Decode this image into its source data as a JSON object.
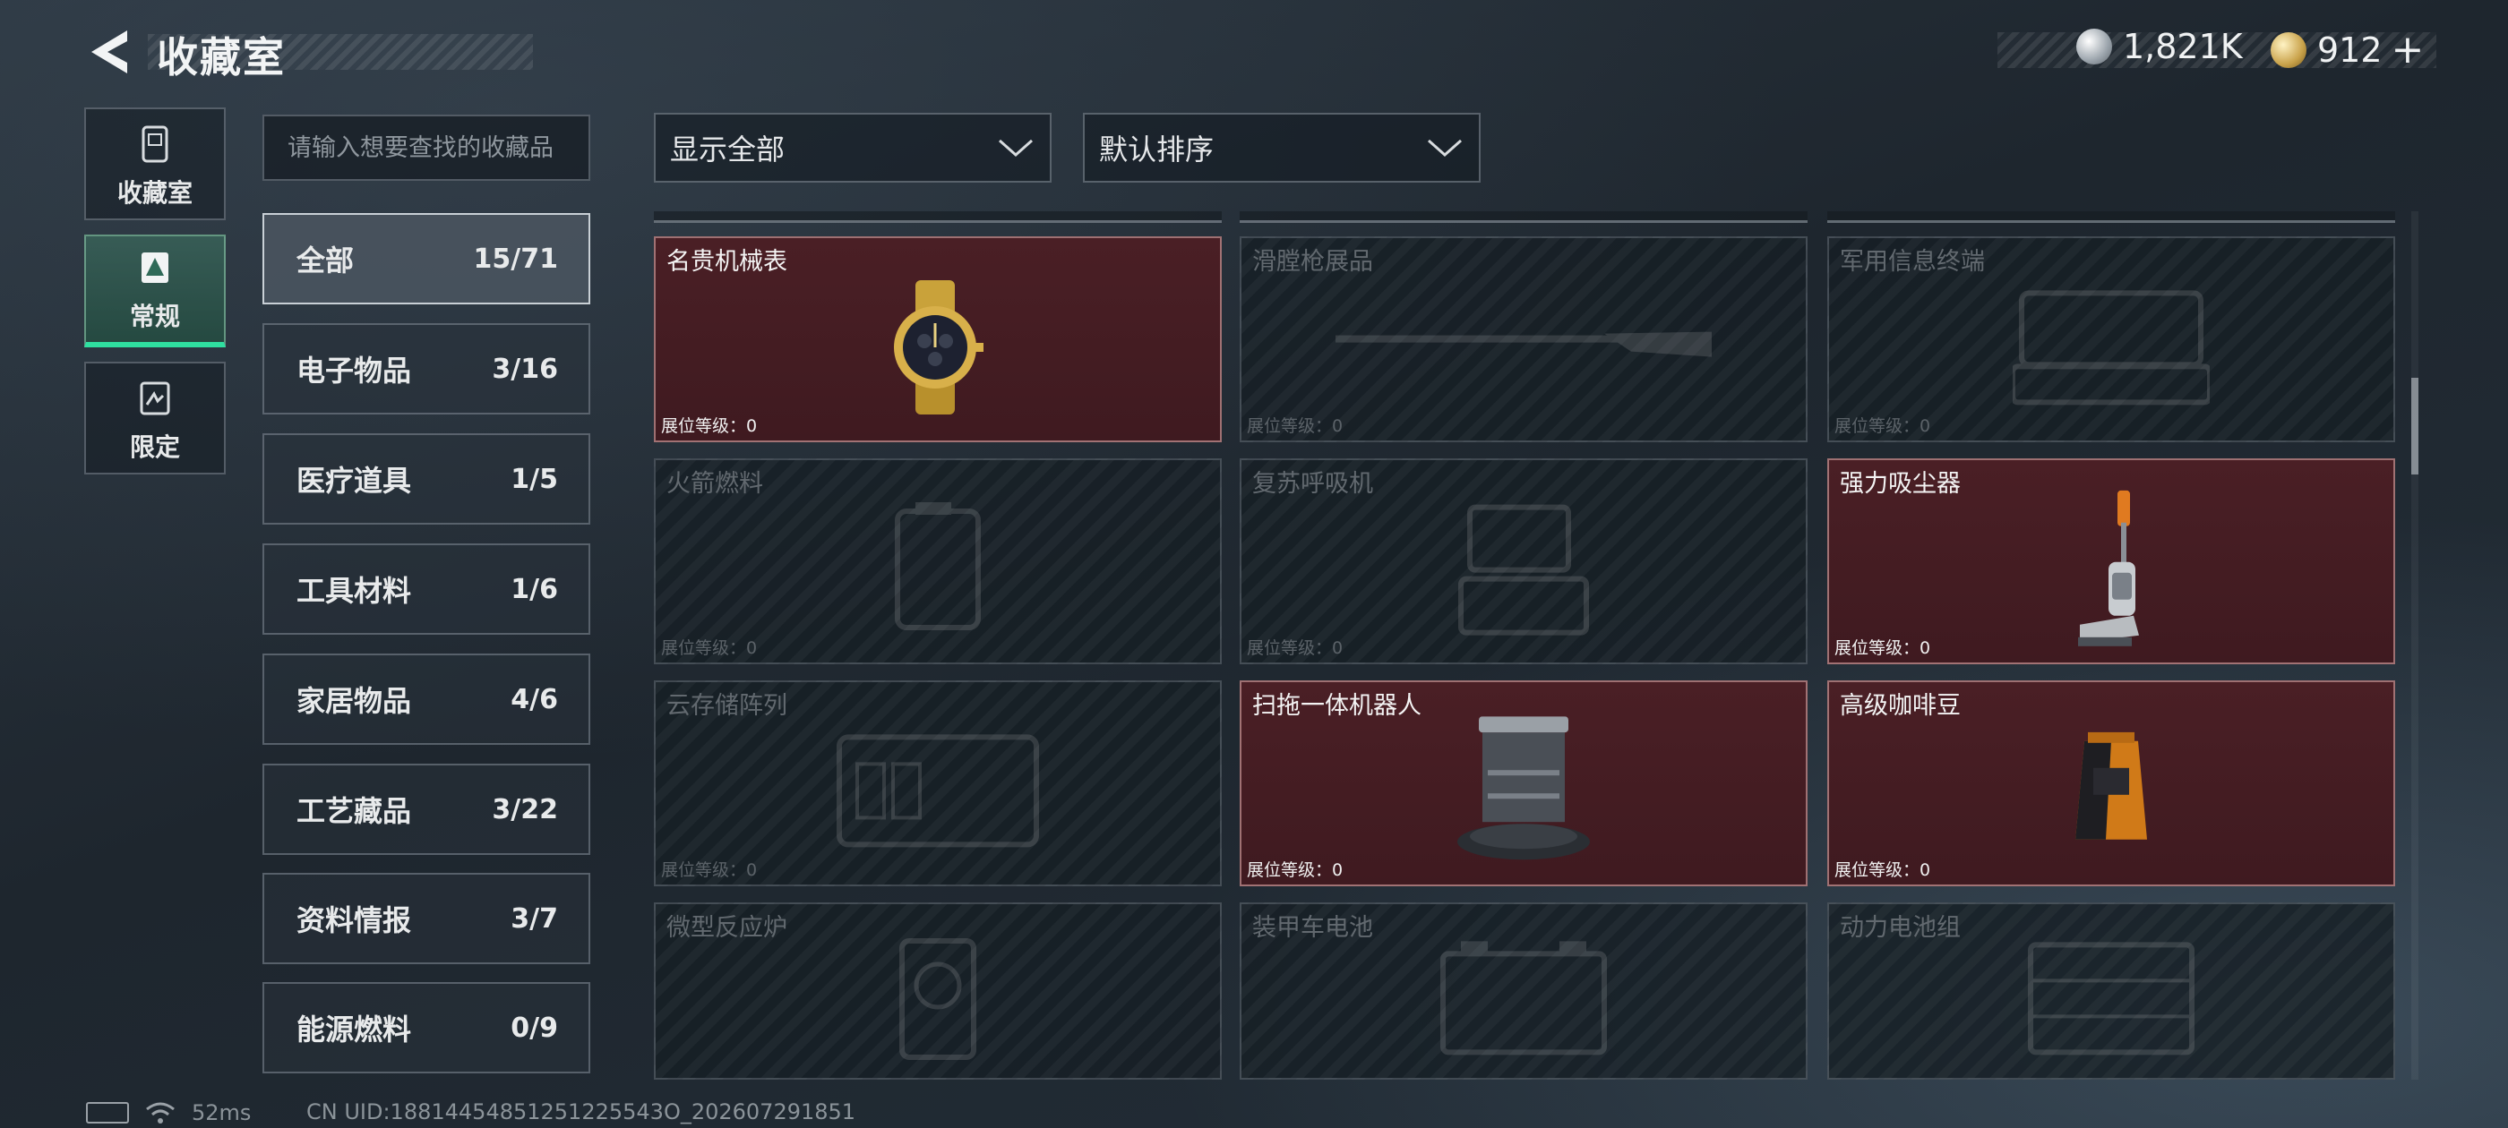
{
  "header": {
    "title": "收藏室",
    "currencies": [
      {
        "icon": "silver-coin-icon",
        "value": "1,821K"
      },
      {
        "icon": "gold-coin-icon",
        "value": "912",
        "add_label": "+"
      }
    ]
  },
  "side_nav": [
    {
      "label": "收藏室",
      "icon": "collection-room-icon",
      "active": false
    },
    {
      "label": "常规",
      "icon": "regular-icon",
      "active": true
    },
    {
      "label": "限定",
      "icon": "limited-icon",
      "active": false
    }
  ],
  "search": {
    "placeholder": "请输入想要查找的收藏品",
    "value": ""
  },
  "categories": [
    {
      "label": "全部",
      "count": "15/71",
      "active": true
    },
    {
      "label": "电子物品",
      "count": "3/16"
    },
    {
      "label": "医疗道具",
      "count": "1/5"
    },
    {
      "label": "工具材料",
      "count": "1/6"
    },
    {
      "label": "家居物品",
      "count": "4/6"
    },
    {
      "label": "工艺藏品",
      "count": "3/22"
    },
    {
      "label": "资料情报",
      "count": "3/7"
    },
    {
      "label": "能源燃料",
      "count": "0/9"
    }
  ],
  "filters": {
    "display": {
      "selected": "显示全部"
    },
    "sort": {
      "selected": "默认排序"
    }
  },
  "items": [
    {
      "name": "名贵机械表",
      "level_label": "展位等级：",
      "level": "0",
      "unlocked": true,
      "icon": "watch-icon"
    },
    {
      "name": "滑膛枪展品",
      "level_label": "展位等级：",
      "level": "0",
      "unlocked": false,
      "icon": "musket-icon"
    },
    {
      "name": "军用信息终端",
      "level_label": "展位等级：",
      "level": "0",
      "unlocked": false,
      "icon": "terminal-icon"
    },
    {
      "name": "火箭燃料",
      "level_label": "展位等级：",
      "level": "0",
      "unlocked": false,
      "icon": "fuel-can-icon"
    },
    {
      "name": "复苏呼吸机",
      "level_label": "展位等级：",
      "level": "0",
      "unlocked": false,
      "icon": "ventilator-icon"
    },
    {
      "name": "强力吸尘器",
      "level_label": "展位等级：",
      "level": "0",
      "unlocked": true,
      "icon": "vacuum-cleaner-icon"
    },
    {
      "name": "云存储阵列",
      "level_label": "展位等级：",
      "level": "0",
      "unlocked": false,
      "icon": "storage-array-icon"
    },
    {
      "name": "扫拖一体机器人",
      "level_label": "展位等级：",
      "level": "0",
      "unlocked": true,
      "icon": "robot-vacuum-icon"
    },
    {
      "name": "高级咖啡豆",
      "level_label": "展位等级：",
      "level": "0",
      "unlocked": true,
      "icon": "coffee-bag-icon"
    },
    {
      "name": "微型反应炉",
      "level_label": "",
      "level": "",
      "unlocked": false,
      "icon": "reactor-icon"
    },
    {
      "name": "装甲车电池",
      "level_label": "",
      "level": "",
      "unlocked": false,
      "icon": "battery-icon"
    },
    {
      "name": "动力电池组",
      "level_label": "",
      "level": "",
      "unlocked": false,
      "icon": "battery-pack-icon"
    }
  ],
  "status": {
    "ping": "52ms",
    "uid": "CN UID:18814454851251225543O_202607291851"
  }
}
